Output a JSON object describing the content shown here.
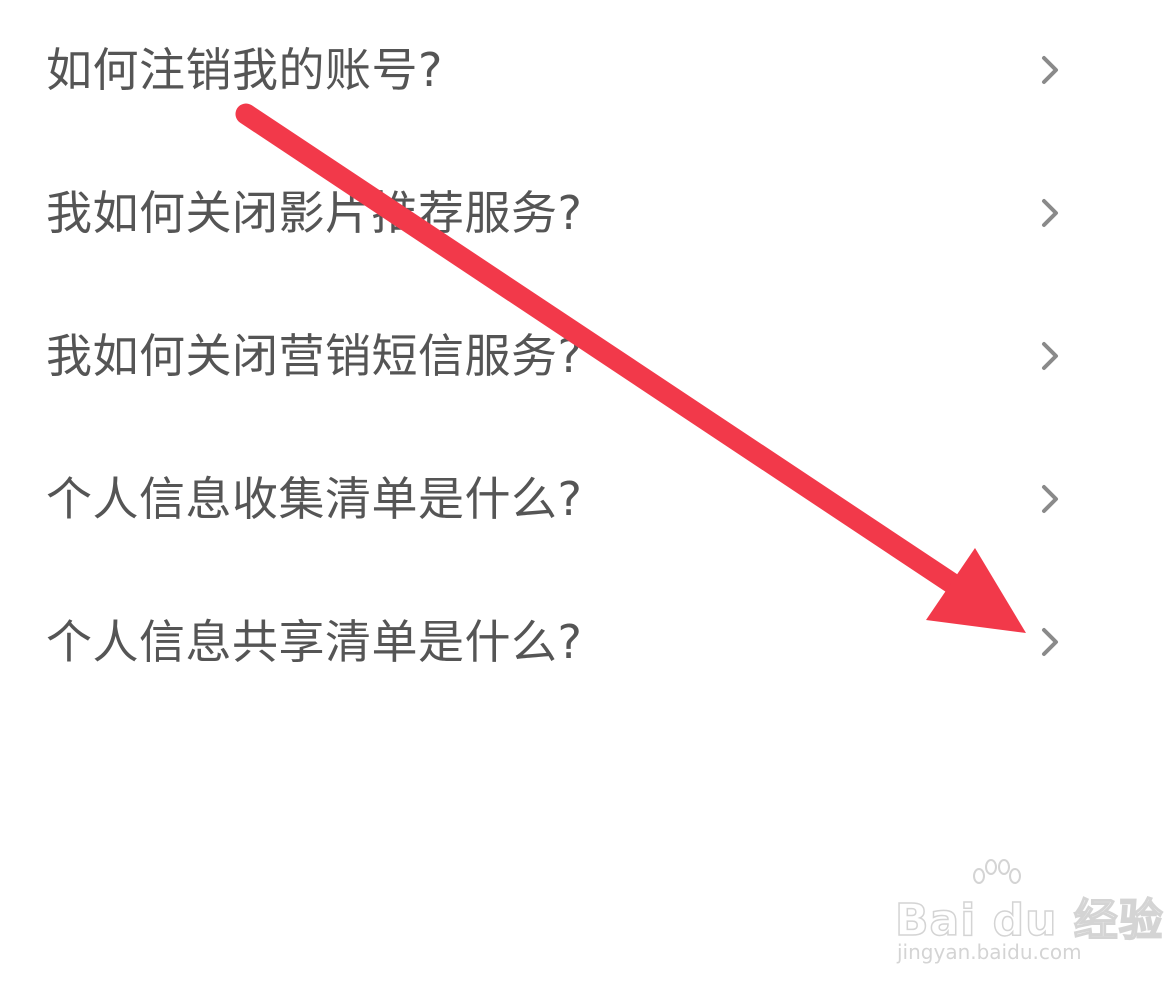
{
  "faq": {
    "items": [
      {
        "label": "如何注销我的账号?"
      },
      {
        "label": "我如何关闭影片推荐服务?"
      },
      {
        "label": "我如何关闭营销短信服务?"
      },
      {
        "label": "个人信息收集清单是什么?"
      },
      {
        "label": "个人信息共享清单是什么?"
      }
    ]
  },
  "icons": {
    "chevron": "chevron-right-icon",
    "annotation": "red-arrow"
  },
  "colors": {
    "text": "#555555",
    "chevron": "#8a8a8a",
    "arrow": "#f2394a",
    "watermark": "#d4d4d4"
  },
  "watermark": {
    "brand": "Bai du 经验",
    "url": "jingyan.baidu.com"
  }
}
